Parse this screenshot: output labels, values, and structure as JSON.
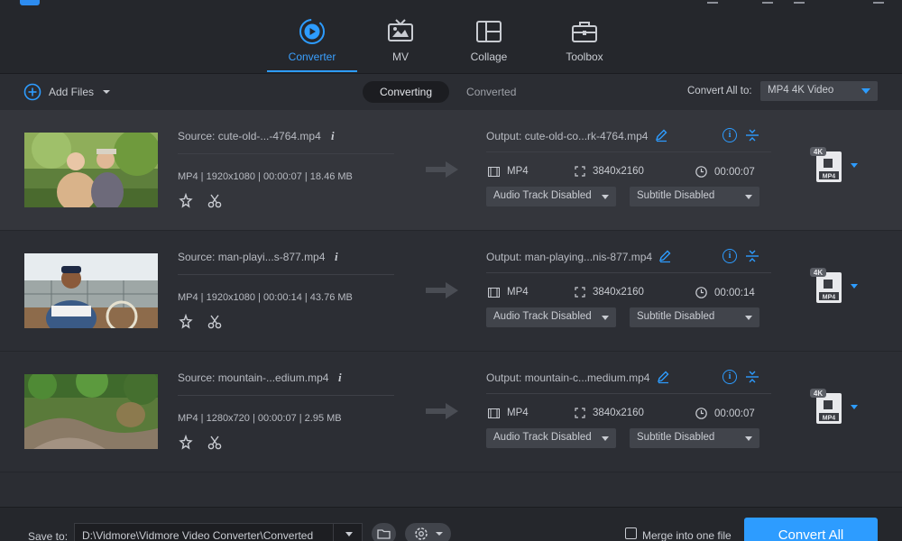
{
  "nav": {
    "tabs": [
      {
        "label": "Converter",
        "icon": "converter-icon",
        "active": true
      },
      {
        "label": "MV",
        "icon": "mv-icon",
        "active": false
      },
      {
        "label": "Collage",
        "icon": "collage-icon",
        "active": false
      },
      {
        "label": "Toolbox",
        "icon": "toolbox-icon",
        "active": false
      }
    ]
  },
  "toolbar": {
    "add_files": "Add Files",
    "tab_converting": "Converting",
    "tab_converted": "Converted",
    "convert_all_to_label": "Convert All to:",
    "format_value": "MP4 4K Video"
  },
  "files": [
    {
      "source": "Source: cute-old-...-4764.mp4",
      "meta": "MP4 | 1920x1080 | 00:00:07 | 18.46 MB",
      "output": "Output: cute-old-co...rk-4764.mp4",
      "out_format": "MP4",
      "out_resolution": "3840x2160",
      "out_duration": "00:00:07",
      "audio": "Audio Track Disabled",
      "subtitle": "Subtitle Disabled",
      "badge": "4K",
      "badge_format": "MP4"
    },
    {
      "source": "Source: man-playi...s-877.mp4",
      "meta": "MP4 | 1920x1080 | 00:00:14 | 43.76 MB",
      "output": "Output: man-playing...nis-877.mp4",
      "out_format": "MP4",
      "out_resolution": "3840x2160",
      "out_duration": "00:00:14",
      "audio": "Audio Track Disabled",
      "subtitle": "Subtitle Disabled",
      "badge": "4K",
      "badge_format": "MP4"
    },
    {
      "source": "Source: mountain-...edium.mp4",
      "meta": "MP4 | 1280x720 | 00:00:07 | 2.95 MB",
      "output": "Output: mountain-c...medium.mp4",
      "out_format": "MP4",
      "out_resolution": "3840x2160",
      "out_duration": "00:00:07",
      "audio": "Audio Track Disabled",
      "subtitle": "Subtitle Disabled",
      "badge": "4K",
      "badge_format": "MP4"
    }
  ],
  "bottom": {
    "save_to_label": "Save to:",
    "save_path": "D:\\Vidmore\\Vidmore Video Converter\\Converted",
    "merge_label": "Merge into one file",
    "convert_all": "Convert All"
  },
  "colors": {
    "accent": "#2d9cff",
    "background": "#2b2d33",
    "topbar": "#25272c"
  }
}
